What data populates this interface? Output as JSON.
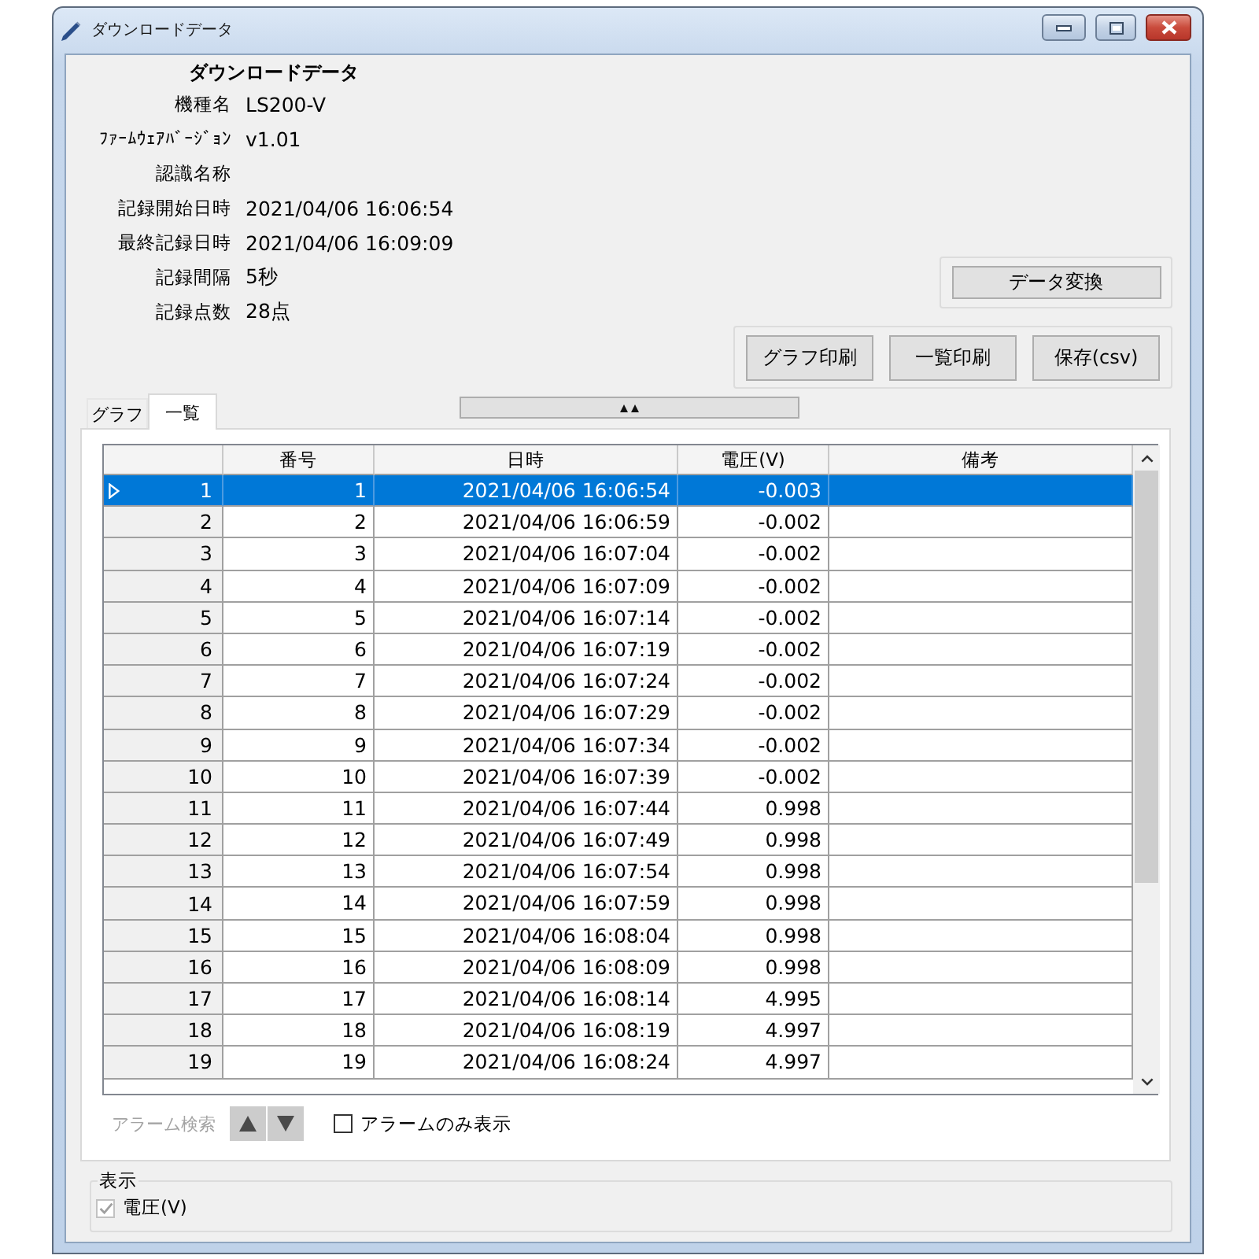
{
  "window": {
    "title": "ダウンロードデータ"
  },
  "header": {
    "title": "ダウンロードデータ",
    "fields": [
      {
        "label": "機種名",
        "value": "LS200-V"
      },
      {
        "label": "ﾌｧｰﾑｳｪｱﾊﾞｰｼﾞｮﾝ",
        "value": "v1.01"
      },
      {
        "label": "認識名称"
      },
      {
        "label": "記録開始日時",
        "value": "2021/04/06 16:06:54"
      },
      {
        "label": "最終記録日時",
        "value": "2021/04/06 16:09:09"
      },
      {
        "label": "記録間隔",
        "value": "5秒"
      },
      {
        "label": "記録点数",
        "value": "28点"
      }
    ]
  },
  "convert_button": "データ変換",
  "output_buttons": [
    "グラフ印刷",
    "一覧印刷",
    "保存(csv)"
  ],
  "tabs": [
    {
      "label": "グラフ",
      "selected": false
    },
    {
      "label": "一覧",
      "selected": true
    }
  ],
  "table": {
    "columns": [
      "番号",
      "日時",
      "電圧(V)",
      "備考"
    ],
    "rows": [
      {
        "row_header": "1",
        "number": "1",
        "datetime": "2021/04/06 16:06:54",
        "voltage": "-0.003",
        "selected": true
      },
      {
        "row_header": "2",
        "number": "2",
        "datetime": "2021/04/06 16:06:59",
        "voltage": "-0.002",
        "selected": false
      },
      {
        "row_header": "3",
        "number": "3",
        "datetime": "2021/04/06 16:07:04",
        "voltage": "-0.002",
        "selected": false
      },
      {
        "row_header": "4",
        "number": "4",
        "datetime": "2021/04/06 16:07:09",
        "voltage": "-0.002",
        "selected": false
      },
      {
        "row_header": "5",
        "number": "5",
        "datetime": "2021/04/06 16:07:14",
        "voltage": "-0.002",
        "selected": false
      },
      {
        "row_header": "6",
        "number": "6",
        "datetime": "2021/04/06 16:07:19",
        "voltage": "-0.002",
        "selected": false
      },
      {
        "row_header": "7",
        "number": "7",
        "datetime": "2021/04/06 16:07:24",
        "voltage": "-0.002",
        "selected": false
      },
      {
        "row_header": "8",
        "number": "8",
        "datetime": "2021/04/06 16:07:29",
        "voltage": "-0.002",
        "selected": false
      },
      {
        "row_header": "9",
        "number": "9",
        "datetime": "2021/04/06 16:07:34",
        "voltage": "-0.002",
        "selected": false
      },
      {
        "row_header": "10",
        "number": "10",
        "datetime": "2021/04/06 16:07:39",
        "voltage": "-0.002",
        "selected": false
      },
      {
        "row_header": "11",
        "number": "11",
        "datetime": "2021/04/06 16:07:44",
        "voltage": "0.998",
        "selected": false
      },
      {
        "row_header": "12",
        "number": "12",
        "datetime": "2021/04/06 16:07:49",
        "voltage": "0.998",
        "selected": false
      },
      {
        "row_header": "13",
        "number": "13",
        "datetime": "2021/04/06 16:07:54",
        "voltage": "0.998",
        "selected": false
      },
      {
        "row_header": "14",
        "number": "14",
        "datetime": "2021/04/06 16:07:59",
        "voltage": "0.998",
        "selected": false
      },
      {
        "row_header": "15",
        "number": "15",
        "datetime": "2021/04/06 16:08:04",
        "voltage": "0.998",
        "selected": false
      },
      {
        "row_header": "16",
        "number": "16",
        "datetime": "2021/04/06 16:08:09",
        "voltage": "0.998",
        "selected": false
      },
      {
        "row_header": "17",
        "number": "17",
        "datetime": "2021/04/06 16:08:14",
        "voltage": "4.995",
        "selected": false
      },
      {
        "row_header": "18",
        "number": "18",
        "datetime": "2021/04/06 16:08:19",
        "voltage": "4.997",
        "selected": false
      },
      {
        "row_header": "19",
        "number": "19",
        "datetime": "2021/04/06 16:08:24",
        "voltage": "4.997",
        "selected": false
      }
    ]
  },
  "alarm_search": {
    "label": "アラーム検索",
    "disabled": true
  },
  "alarm_only": {
    "label": "アラームのみ表示",
    "checked": false
  },
  "display_group": {
    "title": "表示",
    "items": [
      {
        "label": "電圧(V)",
        "checked": true,
        "disabled": true
      }
    ]
  }
}
